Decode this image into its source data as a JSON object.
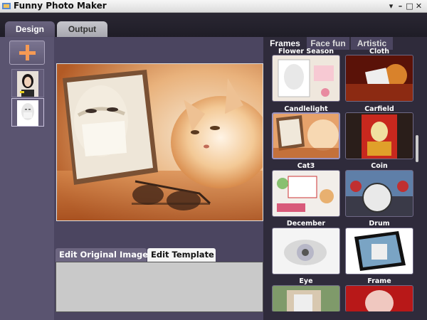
{
  "window": {
    "title": "Funny Photo Maker",
    "controls": {
      "menu": "▾",
      "minimize": "–",
      "maximize": "□",
      "close": "✕"
    }
  },
  "main_tabs": {
    "design": "Design",
    "output": "Output"
  },
  "edit_tabs": {
    "original": "Edit Original Image",
    "template": "Edit Template"
  },
  "right_tabs": {
    "frames": "Frames",
    "face_fun": "Face fun",
    "artistic": "Artistic"
  },
  "frames": [
    {
      "label": "Flower Season"
    },
    {
      "label": "Cloth"
    },
    {
      "label": "Candlelight"
    },
    {
      "label": "Carfield"
    },
    {
      "label": "Cat3"
    },
    {
      "label": "Coin"
    },
    {
      "label": "December"
    },
    {
      "label": "Drum"
    },
    {
      "label": "Eye"
    },
    {
      "label": "Frame"
    }
  ],
  "colors": {
    "accent": "#f59a54",
    "panel": "#5a5470",
    "selection": "#9a93c0"
  },
  "icons": {
    "add": "plus-icon",
    "app": "app-logo-icon"
  }
}
